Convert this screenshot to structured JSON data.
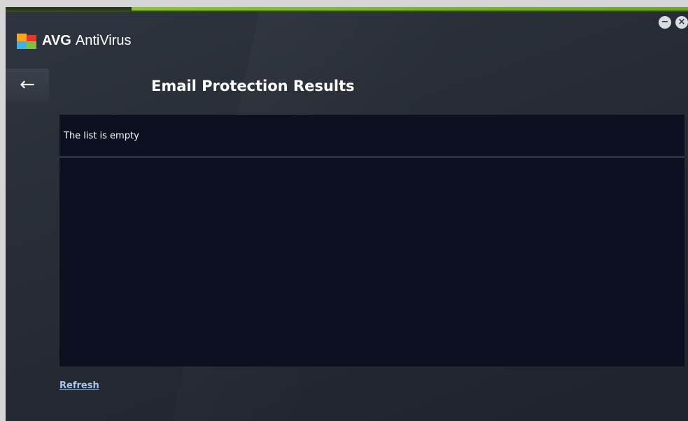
{
  "app": {
    "brand": "AVG",
    "product": "AntiVirus"
  },
  "window_controls": {
    "minimize_symbol": "−",
    "close_symbol": "×"
  },
  "navigation": {
    "back_symbol": "←"
  },
  "page": {
    "title": "Email Protection Results"
  },
  "results": {
    "empty_message": "The list is empty"
  },
  "actions": {
    "refresh_label": "Refresh"
  },
  "colors": {
    "accent_green": "#8fc23a",
    "panel_background": "#0c1020",
    "link": "#a8c8f0"
  },
  "icons": {
    "logo": "avg-logo-icon",
    "minimize": "minimize-icon",
    "close": "close-icon",
    "back": "back-arrow-icon"
  }
}
